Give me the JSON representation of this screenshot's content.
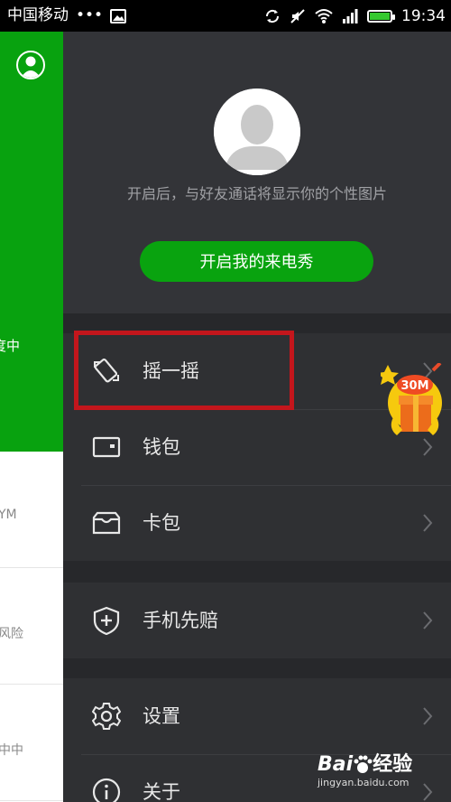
{
  "status_bar": {
    "carrier": "中国移动",
    "dots": "•••",
    "time": "19:34"
  },
  "background_app": {
    "partial_texts": [
      "度中",
      "YM",
      "风险",
      "中中"
    ]
  },
  "drawer": {
    "header": {
      "hint_text": "开启后，与好友通话将显示你的个性图片",
      "cta_label": "开启我的来电秀"
    },
    "menu": [
      {
        "label": "摇一摇",
        "icon": "shake-phone-icon"
      },
      {
        "label": "钱包",
        "icon": "wallet-icon"
      },
      {
        "label": "卡包",
        "icon": "card-holder-icon"
      },
      {
        "label": "手机先赔",
        "icon": "shield-plus-icon"
      },
      {
        "label": "设置",
        "icon": "gear-icon"
      },
      {
        "label": "关于",
        "icon": "info-icon"
      }
    ]
  },
  "promo_badge": {
    "text": "30M"
  },
  "watermark": {
    "brand": "Bai",
    "brand_suffix": "经验",
    "url": "jingyan.baidu.com"
  },
  "colors": {
    "brand_green": "#09a30f",
    "drawer_bg": "#2f3033",
    "highlight_red": "#c3161c"
  }
}
